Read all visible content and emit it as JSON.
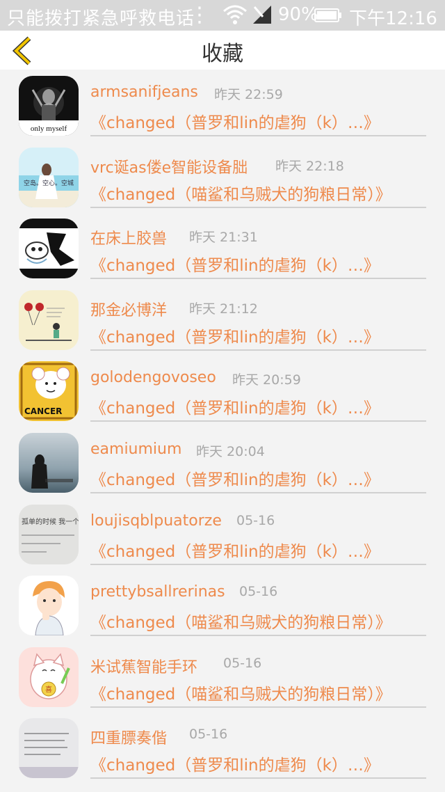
{
  "status_bar": {
    "carrier": "只能拨打紧急呼救电话",
    "battery_percent": "90%",
    "time": "下午12:16"
  },
  "header": {
    "title": "收藏",
    "back_icon": "chevron-left-icon"
  },
  "colors": {
    "accent": "#ee8a4c",
    "back_arrow": "#f2c500",
    "time_gray": "#a8a8a8"
  },
  "items": [
    {
      "name": "armsanifjeans",
      "time": "昨天 22:59",
      "link": "《changed（普罗和lin的虐狗（k）…》"
    },
    {
      "name": "vrc诞as偻e智能设备朏",
      "time": "昨天 22:18",
      "link": "《changed（喵鲨和乌贼犬的狗粮日常）》"
    },
    {
      "name": "在床上胶兽",
      "time": "昨天 21:31",
      "link": "《changed（普罗和lin的虐狗（k）…》"
    },
    {
      "name": "那金必博洋",
      "time": "昨天 21:12",
      "link": "《changed（普罗和lin的虐狗（k）…》"
    },
    {
      "name": "golodengovoseo",
      "time": "昨天 20:59",
      "link": "《changed（普罗和lin的虐狗（k）…》"
    },
    {
      "name": "eamiumium",
      "time": "昨天 20:04",
      "link": "《changed（普罗和lin的虐狗（k）…》"
    },
    {
      "name": "loujisqblpuatorze",
      "time": "05-16",
      "link": "《changed（普罗和lin的虐狗（k）…》"
    },
    {
      "name": "prettybsallrerinas",
      "time": "05-16",
      "link": "《changed（喵鲨和乌贼犬的狗粮日常）》"
    },
    {
      "name": "米试蕉智能手环",
      "time": "05-16",
      "link": "《changed（喵鲨和乌贼犬的狗粮日常）》"
    },
    {
      "name": "四重膘奏偕",
      "time": "05-16",
      "link": "《changed（普罗和lin的虐狗（k）…》"
    }
  ],
  "avatar_texts": {
    "a1": "only myself",
    "a2": "空岛。空心。空城",
    "a5": "CANCER",
    "a7": "孤单的时候 我一个人做着 梦呢",
    "a9": "喜"
  }
}
